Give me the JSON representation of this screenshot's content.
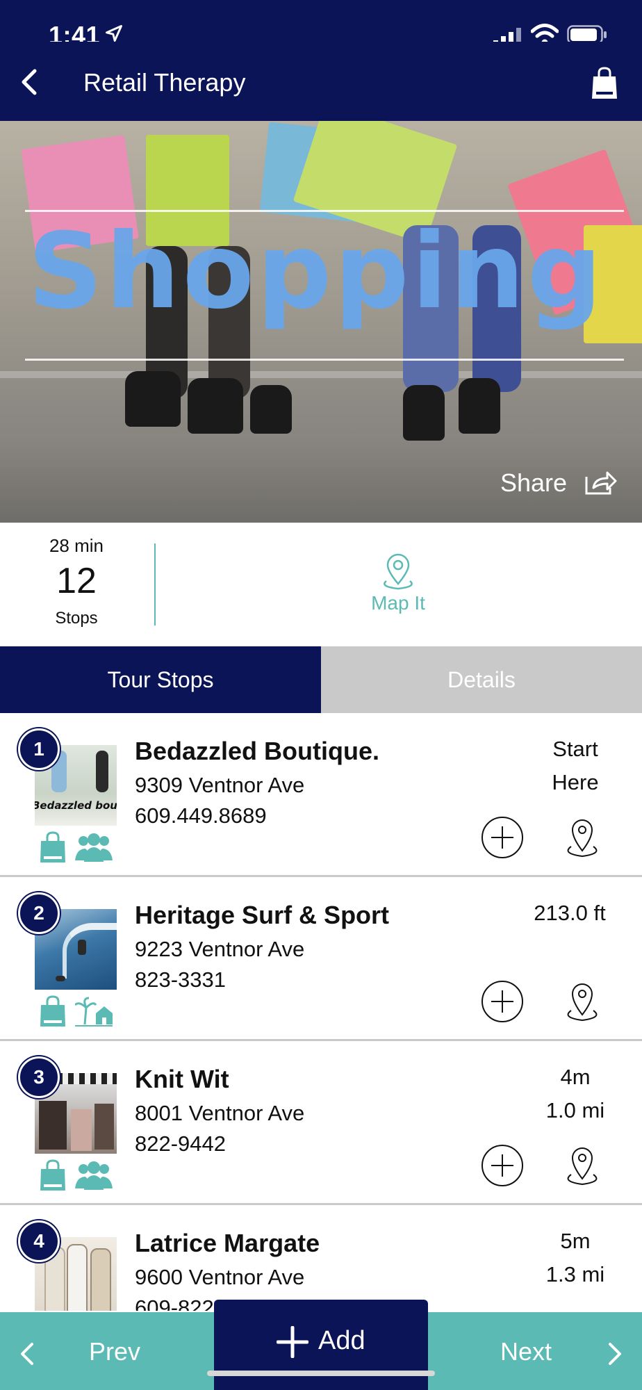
{
  "status_bar": {
    "time": "1:41"
  },
  "nav": {
    "title": "Retail Therapy"
  },
  "hero": {
    "word": "Shopping",
    "share_label": "Share"
  },
  "summary": {
    "minutes": "28 min",
    "stop_count": "12",
    "stops_label": "Stops",
    "map_label": "Map It"
  },
  "tabs": [
    {
      "label": "Tour Stops"
    },
    {
      "label": "Details"
    }
  ],
  "stops": [
    {
      "number": "1",
      "name": "Bedazzled Boutique.",
      "address": "9309 Ventnor Ave",
      "phone": "609.449.8689",
      "line1": "Start",
      "line2": "Here",
      "thumb_text": "Bedazzled bout"
    },
    {
      "number": "2",
      "name": "Heritage Surf & Sport",
      "address": "9223 Ventnor Ave",
      "phone": "823-3331",
      "line1": "213.0 ft",
      "line2": ""
    },
    {
      "number": "3",
      "name": "Knit Wit",
      "address": "8001 Ventnor Ave",
      "phone": "822-9442",
      "line1": "4m",
      "line2": "1.0 mi"
    },
    {
      "number": "4",
      "name": "Latrice Margate",
      "address": "9600 Ventnor Ave",
      "phone": "609-822",
      "line1": "5m",
      "line2": "1.3 mi"
    }
  ],
  "bottom": {
    "prev_label": "Prev",
    "add_label": "Add",
    "next_label": "Next"
  },
  "colors": {
    "navy": "#0b1457",
    "teal": "#5bbab3",
    "gray_tab": "#c9c9c9",
    "hero_text": "#6aa6ea"
  }
}
